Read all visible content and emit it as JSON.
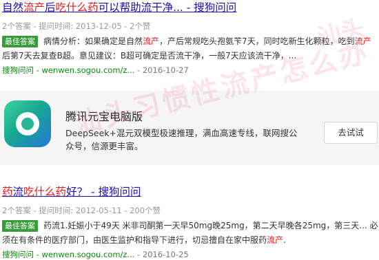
{
  "results": [
    {
      "title_parts": [
        "自然",
        "流产",
        "后",
        "吃什么",
        "药",
        "可以帮助流干净... - 搜狗问问"
      ],
      "meta": "2个答案 - 提问时间: 2013-12-05 - 2个赞",
      "badge": "最佳答案",
      "answer_parts": [
        "病情分析：如果确定是自然",
        "流产",
        "，产后常规吃头孢氨苄7天，同时吃新生化颗粒，吃到",
        "流产",
        "后第7天去复查B超。意见建议：B超可确定是否流干净，一般7天应该流干净，..."
      ],
      "source": "搜狗问问 - wenwen.sogou.com/z...",
      "date": " - 2016-10-27"
    },
    {
      "title_parts": [
        "药",
        "流",
        "吃什么",
        "药",
        "好？ - 搜狗问问"
      ],
      "meta": "2个答案 - 提问时间: 2012-05-11 - 200个赞",
      "badge": "最佳答案",
      "answer_parts": [
        "药流1.妊娠小于49天 米非司酮第一天早50mg晚25mg，第二天早晚各25mg，第三天... 必须在有条件的医疗部门，由医生监护和指导下进行，切忌擅自在家中服药",
        "流产",
        "."
      ],
      "source": "搜狗问问 - wenwen.sogou.com/z...",
      "date": " - 2016-10-25"
    }
  ],
  "ad": {
    "title": "腾讯元宝电脑版",
    "desc": "DeepSeek+混元双模型极速推理，满血高速专线，联网搜公众号，信源更丰富。",
    "button": "去试试",
    "logo_icon": "yuanbao-logo-icon"
  },
  "watermark": "汕头习惯性流产怎么办",
  "watermark2": "汕头"
}
